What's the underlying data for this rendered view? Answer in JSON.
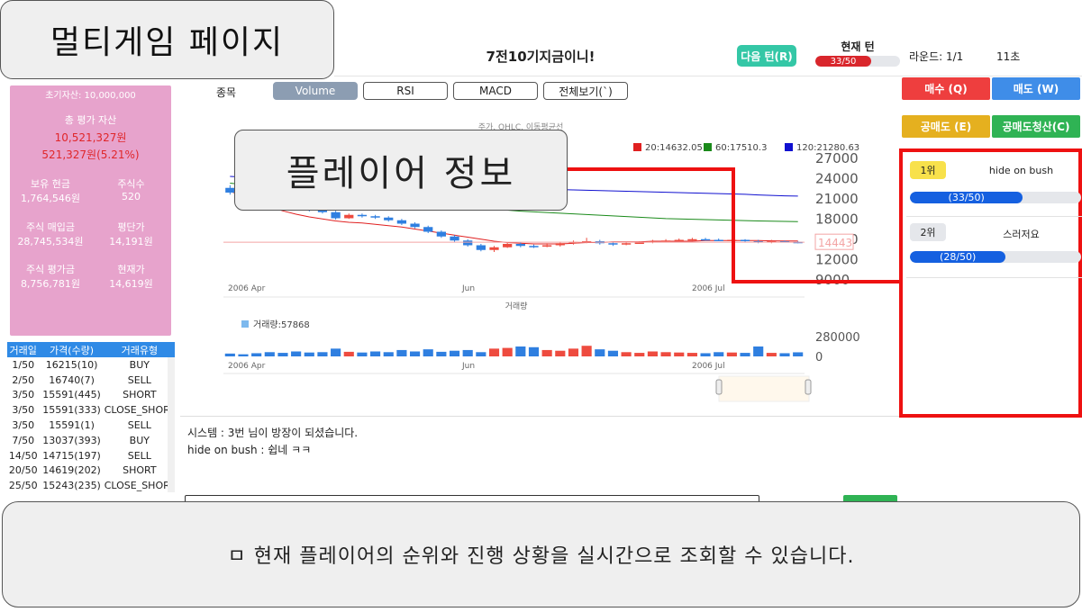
{
  "slide_title": "멀티게임 페이지",
  "header": {
    "room_title": "7전10기지금이니!",
    "next_turn_label": "다음 턴(R)",
    "turn_label": "현재 턴",
    "turn_progress": "33/50",
    "turn_fraction": 0.66,
    "round": "라운드: 1/1",
    "timer": "11초"
  },
  "assets": {
    "initial": "초기자산: 10,000,000",
    "total_label": "총 평가 자산",
    "total_value": "10,521,327원",
    "total_change": "521,327원(5.21%)",
    "cash_label": "보유 현금",
    "cash_value": "1,764,546원",
    "shares_label": "주식수",
    "shares_value": "520",
    "buy_amount_label": "주식 매입금",
    "buy_amount_value": "28,745,534원",
    "avg_price_label": "평단가",
    "avg_price_value": "14,191원",
    "eval_label": "주식 평가금",
    "eval_value": "8,756,781원",
    "current_label": "현재가",
    "current_value": "14,619원"
  },
  "trades": {
    "headers": [
      "거래일",
      "가격(수량)",
      "거래유형"
    ],
    "rows": [
      [
        "1/50",
        "16215(10)",
        "BUY"
      ],
      [
        "2/50",
        "16740(7)",
        "SELL"
      ],
      [
        "3/50",
        "15591(445)",
        "SHORT"
      ],
      [
        "3/50",
        "15591(333)",
        "CLOSE_SHORT"
      ],
      [
        "3/50",
        "15591(1)",
        "SELL"
      ],
      [
        "7/50",
        "13037(393)",
        "BUY"
      ],
      [
        "14/50",
        "14715(197)",
        "SELL"
      ],
      [
        "20/50",
        "14619(202)",
        "SHORT"
      ],
      [
        "25/50",
        "15243(235)",
        "CLOSE_SHORT"
      ]
    ]
  },
  "toolbar": {
    "stock_label": "종목",
    "volume": "Volume",
    "rsi": "RSI",
    "macd": "MACD",
    "all": "전체보기(`)"
  },
  "chart_data": {
    "type": "candlestick",
    "title": "주가, OHLC, 이동평균선",
    "ma_legend": [
      {
        "name": "20",
        "value": "20:14632.05",
        "color": "#e02020"
      },
      {
        "name": "60",
        "value": "60:17510.3",
        "color": "#1a8a1a"
      },
      {
        "name": "120",
        "value": "120:21280.63",
        "color": "#1010d0"
      }
    ],
    "y_ticks": [
      "27000",
      "24000",
      "21000",
      "18000",
      "15000",
      "12000",
      "9000"
    ],
    "ylim": [
      9000,
      27000
    ],
    "x_ticks": [
      "2006 Apr",
      "Jun",
      "2006 Jul"
    ],
    "current_price_tag": "14443",
    "candles": [
      {
        "o": 22500,
        "c": 21800,
        "h": 22900,
        "l": 21500
      },
      {
        "o": 21800,
        "c": 21200,
        "h": 22000,
        "l": 20900
      },
      {
        "o": 21200,
        "c": 20600,
        "h": 21400,
        "l": 20300
      },
      {
        "o": 20600,
        "c": 20100,
        "h": 20800,
        "l": 19800
      },
      {
        "o": 20100,
        "c": 19900,
        "h": 20400,
        "l": 19700
      },
      {
        "o": 19900,
        "c": 19500,
        "h": 20100,
        "l": 19300
      },
      {
        "o": 19500,
        "c": 19200,
        "h": 19800,
        "l": 19000
      },
      {
        "o": 19200,
        "c": 18900,
        "h": 19400,
        "l": 18700
      },
      {
        "o": 18900,
        "c": 18000,
        "h": 19100,
        "l": 17800
      },
      {
        "o": 18000,
        "c": 18500,
        "h": 18700,
        "l": 17900
      },
      {
        "o": 18500,
        "c": 18300,
        "h": 18700,
        "l": 18100
      },
      {
        "o": 18300,
        "c": 18100,
        "h": 18500,
        "l": 17900
      },
      {
        "o": 18100,
        "c": 17700,
        "h": 18300,
        "l": 17500
      },
      {
        "o": 17700,
        "c": 17200,
        "h": 17900,
        "l": 17000
      },
      {
        "o": 17200,
        "c": 16700,
        "h": 17400,
        "l": 16500
      },
      {
        "o": 16700,
        "c": 16000,
        "h": 16900,
        "l": 15800
      },
      {
        "o": 16000,
        "c": 15300,
        "h": 16200,
        "l": 15100
      },
      {
        "o": 15300,
        "c": 14700,
        "h": 15500,
        "l": 14500
      },
      {
        "o": 14700,
        "c": 14000,
        "h": 14900,
        "l": 13800
      },
      {
        "o": 14000,
        "c": 13300,
        "h": 14200,
        "l": 13100
      },
      {
        "o": 13300,
        "c": 13700,
        "h": 13900,
        "l": 13000
      },
      {
        "o": 13700,
        "c": 14200,
        "h": 14400,
        "l": 13600
      },
      {
        "o": 14200,
        "c": 13900,
        "h": 14400,
        "l": 13700
      },
      {
        "o": 13900,
        "c": 13800,
        "h": 14100,
        "l": 13600
      },
      {
        "o": 13800,
        "c": 14000,
        "h": 14300,
        "l": 13700
      },
      {
        "o": 14000,
        "c": 14300,
        "h": 14500,
        "l": 13800
      },
      {
        "o": 14300,
        "c": 14500,
        "h": 14700,
        "l": 14100
      },
      {
        "o": 14500,
        "c": 14600,
        "h": 15100,
        "l": 14300
      },
      {
        "o": 14600,
        "c": 14300,
        "h": 14800,
        "l": 14100
      },
      {
        "o": 14300,
        "c": 14100,
        "h": 14500,
        "l": 13900
      },
      {
        "o": 14100,
        "c": 14300,
        "h": 14500,
        "l": 14000
      },
      {
        "o": 14300,
        "c": 14400,
        "h": 14600,
        "l": 14200
      },
      {
        "o": 14400,
        "c": 14600,
        "h": 14800,
        "l": 14300
      },
      {
        "o": 14600,
        "c": 14700,
        "h": 14900,
        "l": 14500
      },
      {
        "o": 14700,
        "c": 14800,
        "h": 15000,
        "l": 14600
      },
      {
        "o": 14800,
        "c": 14900,
        "h": 15100,
        "l": 14700
      },
      {
        "o": 14900,
        "c": 14800,
        "h": 15100,
        "l": 14700
      },
      {
        "o": 14800,
        "c": 14700,
        "h": 15000,
        "l": 14600
      },
      {
        "o": 14700,
        "c": 14800,
        "h": 14900,
        "l": 14600
      },
      {
        "o": 14800,
        "c": 14600,
        "h": 14900,
        "l": 14500
      },
      {
        "o": 14600,
        "c": 14400,
        "h": 14800,
        "l": 14300
      },
      {
        "o": 14400,
        "c": 14600,
        "h": 14800,
        "l": 14300
      },
      {
        "o": 14600,
        "c": 14500,
        "h": 14700,
        "l": 14400
      },
      {
        "o": 14500,
        "c": 14443,
        "h": 14600,
        "l": 14300
      }
    ],
    "ma20": [
      22000,
      21300,
      20500,
      19700,
      19100,
      18600,
      18200,
      17900,
      17600,
      17400,
      17300,
      17100,
      16900,
      16700,
      16400,
      16100,
      15800,
      15500,
      15200,
      14900,
      14600,
      14400,
      14300,
      14200,
      14200,
      14200,
      14300,
      14400,
      14400,
      14500,
      14500,
      14500,
      14600,
      14600,
      14600,
      14600,
      14700,
      14700,
      14700,
      14700,
      14700,
      14650,
      14640,
      14632
    ],
    "ma60": [
      23200,
      23000,
      22800,
      22600,
      22400,
      22200,
      22000,
      21800,
      21600,
      21400,
      21200,
      21000,
      20800,
      20600,
      20400,
      20200,
      20000,
      19800,
      19650,
      19500,
      19350,
      19200,
      19050,
      18950,
      18850,
      18750,
      18650,
      18550,
      18450,
      18350,
      18250,
      18150,
      18050,
      17950,
      17900,
      17850,
      17800,
      17750,
      17700,
      17650,
      17600,
      17560,
      17530,
      17510
    ],
    "ma120": [
      24200,
      24100,
      24000,
      23900,
      23800,
      23700,
      23600,
      23500,
      23400,
      23300,
      23200,
      23100,
      23000,
      22900,
      22800,
      22750,
      22700,
      22650,
      22600,
      22550,
      22500,
      22450,
      22400,
      22350,
      22300,
      22250,
      22200,
      22150,
      22100,
      22050,
      22000,
      21950,
      21900,
      21850,
      21800,
      21750,
      21700,
      21650,
      21600,
      21550,
      21450,
      21380,
      21320,
      21281
    ],
    "volume_label": "거래량",
    "volume_legend": "거래량:57868",
    "volume_ticks": [
      "280000",
      "0"
    ],
    "volume_max": 280000,
    "volumes": [
      40000,
      30000,
      45000,
      60000,
      50000,
      70000,
      55000,
      60000,
      110000,
      65000,
      55000,
      70000,
      60000,
      90000,
      70000,
      100000,
      65000,
      80000,
      90000,
      60000,
      110000,
      120000,
      140000,
      130000,
      90000,
      80000,
      110000,
      150000,
      100000,
      80000,
      60000,
      50000,
      70000,
      60000,
      55000,
      50000,
      45000,
      60000,
      55000,
      50000,
      140000,
      50000,
      45000,
      57868
    ]
  },
  "orders": {
    "buy": "매수 (Q)",
    "sell": "매도 (W)",
    "short": "공매도 (E)",
    "cover": "공매도청산(C)"
  },
  "callout": "플레이어 정보",
  "ranking": [
    {
      "rank": "1위",
      "name": "hide on bush",
      "progress": "(33/50)",
      "fraction": 0.66,
      "badge_color": "#f8e14b"
    },
    {
      "rank": "2위",
      "name": "스러저요",
      "progress": "(28/50)",
      "fraction": 0.56,
      "badge_color": "#e5e7eb"
    }
  ],
  "chat": {
    "lines": [
      "시스템 : 3번 님이 방장이 되셨습니다.",
      "hide on bush : 쉽네 ㅋㅋ"
    ]
  },
  "caption": "ㅁ 현재 플레이어의 순위와 진행 상황을 실시간으로 조회할 수 있습니다."
}
